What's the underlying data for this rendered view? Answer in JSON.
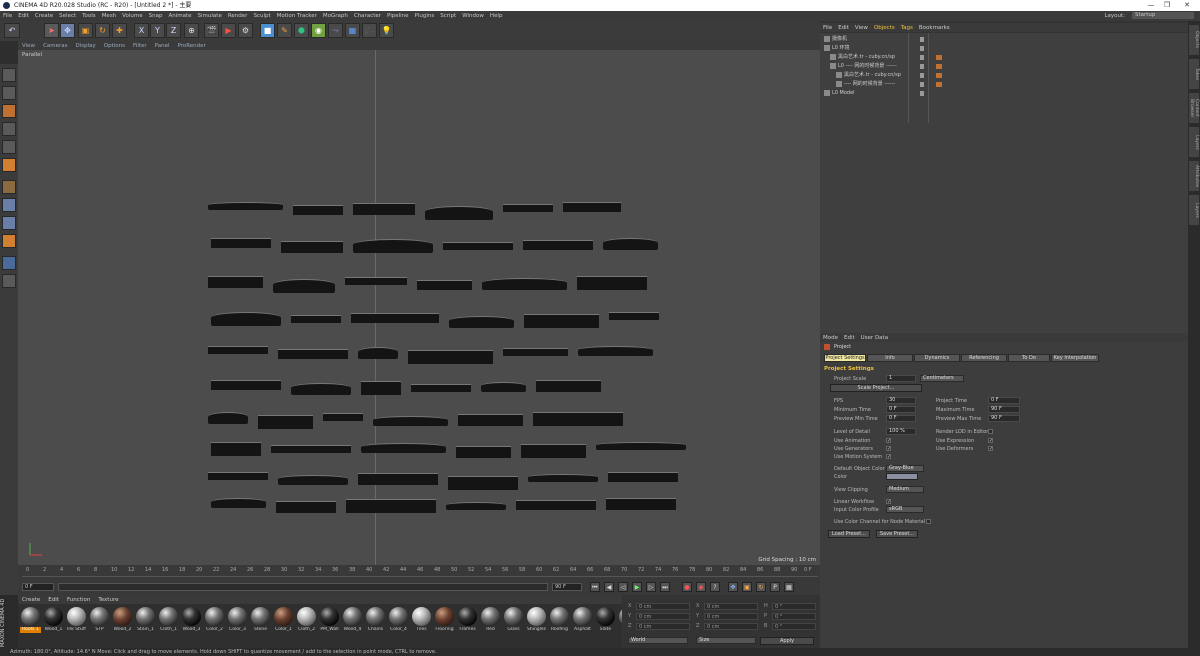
{
  "window": {
    "title": "CINEMA 4D R20.028 Studio (RC - R20) - [Untitled 2 *] - 主要",
    "layout_label": "Layout:",
    "layout_value": "Startup",
    "min": "—",
    "max": "❐",
    "close": "✕"
  },
  "menu": [
    "File",
    "Edit",
    "Create",
    "Select",
    "Tools",
    "Mesh",
    "Volume",
    "Snap",
    "Animate",
    "Simulate",
    "Render",
    "Sculpt",
    "Motion Tracker",
    "MoGraph",
    "Character",
    "Pipeline",
    "Plugins",
    "Script",
    "Window",
    "Help"
  ],
  "toolbar": {
    "undo": "↶",
    "x": "X",
    "y": "Y",
    "z": "Z"
  },
  "viewport": {
    "menu": [
      "View",
      "Cameras",
      "Display",
      "Options",
      "Filter",
      "Panel",
      "ProRender"
    ],
    "label": "Parallel",
    "grid_spacing": "Grid Spacing : 10 cm"
  },
  "timeline": {
    "ticks": [
      "0",
      "2",
      "4",
      "6",
      "8",
      "10",
      "12",
      "14",
      "16",
      "18",
      "20",
      "22",
      "24",
      "26",
      "28",
      "30",
      "32",
      "34",
      "36",
      "38",
      "40",
      "42",
      "44",
      "46",
      "48",
      "50",
      "52",
      "54",
      "56",
      "58",
      "60",
      "62",
      "64",
      "66",
      "68",
      "70",
      "72",
      "74",
      "76",
      "78",
      "80",
      "82",
      "84",
      "86",
      "88",
      "90"
    ],
    "end_frame": "0 F",
    "start": "0 F",
    "field2": "0 F",
    "field3": "90 F",
    "field4": "90 F"
  },
  "material_manager": {
    "menu": [
      "Create",
      "Edit",
      "Function",
      "Texture"
    ],
    "materials": [
      "Roofs 1",
      "Wood_1",
      "Ink Stuff",
      "STP",
      "Wood_2",
      "Stain_1",
      "Cloth_1",
      "Wood_3",
      "Color_2",
      "Color_3",
      "Stone",
      "Color_1",
      "Cloth_2",
      "PM_Wall",
      "Wood_4",
      "Chains",
      "Color_4",
      "Tiles",
      "Flooring",
      "Frames",
      "Red",
      "Glass",
      "Shingles",
      "Roofing",
      "Asphalt",
      "Slate",
      "Bricks"
    ],
    "maxon_text": "MAXON CINEMA 4D"
  },
  "coords": {
    "rows": [
      {
        "a": "X",
        "b": "0 cm",
        "c": "X",
        "d": "0 cm",
        "e": "H",
        "f": "0 °"
      },
      {
        "a": "Y",
        "b": "0 cm",
        "c": "Y",
        "d": "0 cm",
        "e": "P",
        "f": "0 °"
      },
      {
        "a": "Z",
        "b": "0 cm",
        "c": "Z",
        "d": "0 cm",
        "e": "B",
        "f": "0 °"
      }
    ],
    "world": "World",
    "size": "Size",
    "apply": "Apply"
  },
  "object_manager": {
    "menu": [
      "File",
      "Edit",
      "View",
      "Objects",
      "Tags",
      "Bookmarks"
    ],
    "objects": [
      {
        "name": "摄像机",
        "indent": 0
      },
      {
        "name": "L0 环境",
        "indent": 0
      },
      {
        "name": "黑白艺术.tr - cuby.cn/sp",
        "indent": 1
      },
      {
        "name": "L0 ---- 网的时候背景 ------",
        "indent": 1
      },
      {
        "name": "黑白艺术.tr - cuby.cn/sp",
        "indent": 2
      },
      {
        "name": "---- 网的时候背景 ------",
        "indent": 2
      },
      {
        "name": "L0 Model",
        "indent": 0
      }
    ]
  },
  "attributes": {
    "menu": [
      "Mode",
      "Edit",
      "User Data"
    ],
    "title": "Project",
    "tabs": [
      "Project Settings",
      "Info",
      "Dynamics",
      "Referencing",
      "To Do",
      "Key Interpolation"
    ],
    "section": "Project Settings",
    "project_scale_label": "Project Scale",
    "project_scale_value": "1",
    "project_scale_unit": "Centimeters",
    "scale_project_btn": "Scale Project...",
    "fps_label": "FPS",
    "fps": "30",
    "project_time_label": "Project Time",
    "project_time": "0 F",
    "min_time_label": "Minimum Time",
    "min_time": "0 F",
    "max_time_label": "Maximum Time",
    "max_time": "90 F",
    "prev_min_label": "Preview Min Time",
    "prev_min": "0 F",
    "prev_max_label": "Preview Max Time",
    "prev_max": "90 F",
    "lod_label": "Level of Detail",
    "lod": "100 %",
    "render_lod_label": "Render LOD in Editor",
    "use_anim_label": "Use Animation",
    "use_expr_label": "Use Expression",
    "use_gen_label": "Use Generators",
    "use_deform_label": "Use Deformers",
    "use_motion_label": "Use Motion System",
    "default_color_label": "Default Object Color",
    "default_color": "Gray-Blue",
    "color_label": "Color",
    "view_clip_label": "View Clipping",
    "view_clip": "Medium",
    "linear_label": "Linear Workflow",
    "input_profile_label": "Input Color Profile",
    "input_profile": "sRGB",
    "use_color_channel_label": "Use Color Channel for Node Material",
    "load_preset": "Load Preset...",
    "save_preset": "Save Preset..."
  },
  "side_tabs": [
    "Objects",
    "Takes",
    "Content Browser",
    "Layers",
    "Attributes",
    "Layers"
  ],
  "status": "Azimuth: 180.0°, Altitude: 14.6°  N     Move: Click and drag to move elements. Hold down SHIFT to quantize movement / add to the selection in point mode, CTRL to remove."
}
